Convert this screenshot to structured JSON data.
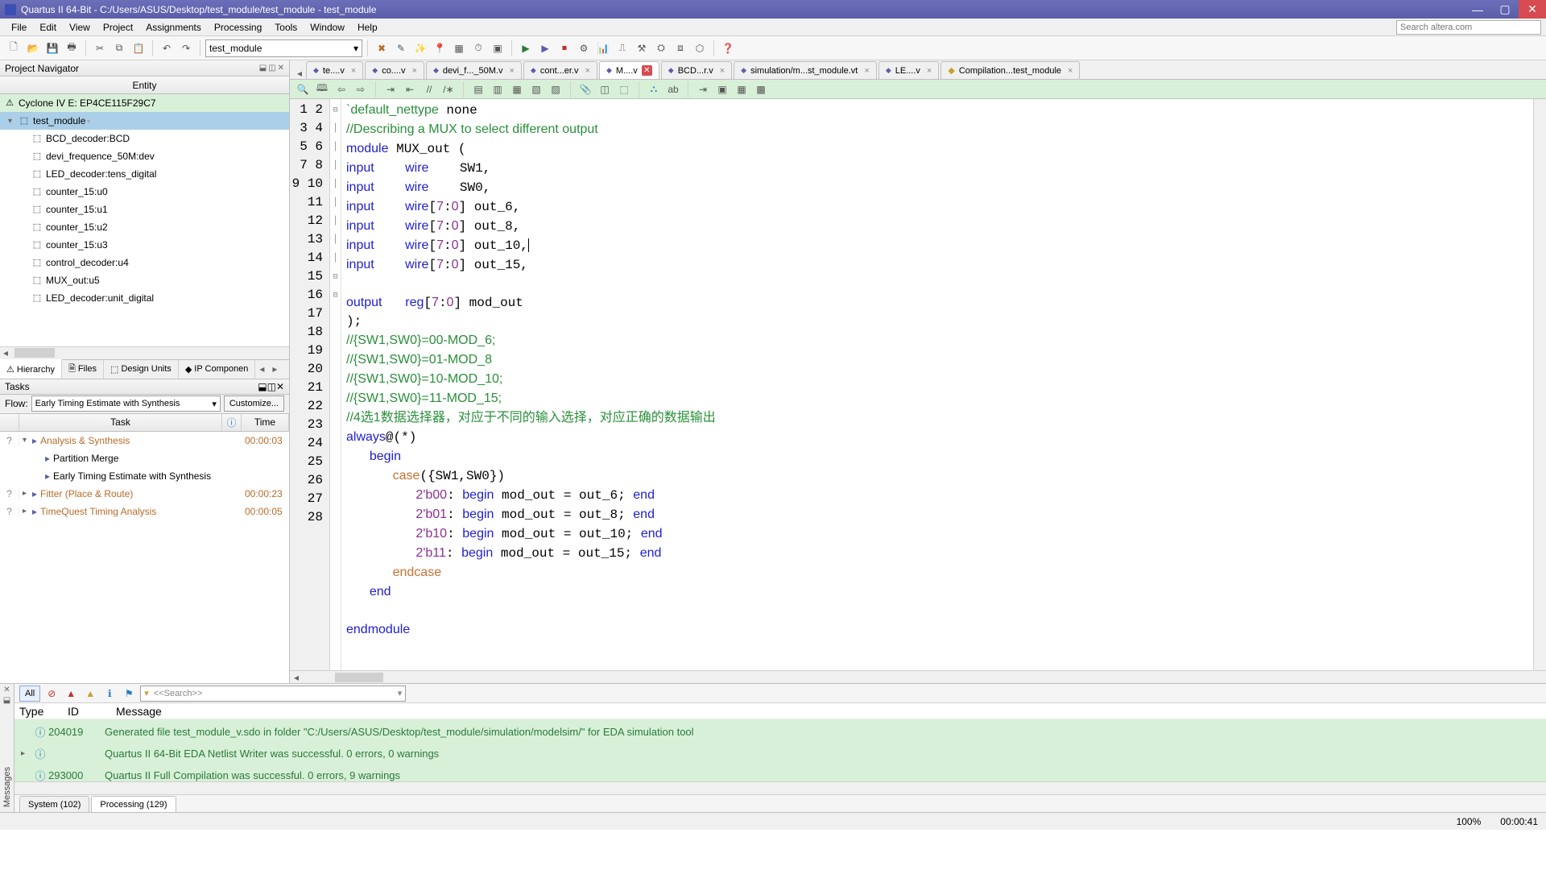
{
  "title": "Quartus II 64-Bit - C:/Users/ASUS/Desktop/test_module/test_module - test_module",
  "menus": [
    "File",
    "Edit",
    "View",
    "Project",
    "Assignments",
    "Processing",
    "Tools",
    "Window",
    "Help"
  ],
  "search_placeholder": "Search altera.com",
  "project_select": "test_module",
  "left": {
    "nav_title": "Project Navigator",
    "entity_header": "Entity",
    "device": "Cyclone IV E: EP4CE115F29C7",
    "top": "test_module",
    "instances": [
      "BCD_decoder:BCD",
      "devi_frequence_50M:dev",
      "LED_decoder:tens_digital",
      "counter_15:u0",
      "counter_15:u1",
      "counter_15:u2",
      "counter_15:u3",
      "control_decoder:u4",
      "MUX_out:u5",
      "LED_decoder:unit_digital"
    ],
    "tabs": [
      "Hierarchy",
      "Files",
      "Design Units",
      "IP Componen"
    ],
    "tasks_title": "Tasks",
    "flow_label": "Flow:",
    "flow_value": "Early Timing Estimate with Synthesis",
    "customize": "Customize...",
    "task_cols": [
      "Task",
      "Time"
    ],
    "status_icon": "ⓘ",
    "tasks": [
      {
        "name": "Analysis & Synthesis",
        "time": "00:00:03",
        "orange": true,
        "q": true,
        "exp": "▾",
        "arrow": true
      },
      {
        "name": "Partition Merge",
        "time": "",
        "orange": false,
        "q": false,
        "exp": "",
        "arrow": true,
        "indent": 16
      },
      {
        "name": "Early Timing Estimate with Synthesis",
        "time": "",
        "orange": false,
        "q": false,
        "exp": "",
        "arrow": true,
        "indent": 16
      },
      {
        "name": "Fitter (Place & Route)",
        "time": "00:00:23",
        "orange": true,
        "q": true,
        "exp": "▸",
        "arrow": true
      },
      {
        "name": "TimeQuest Timing Analysis",
        "time": "00:00:05",
        "orange": true,
        "q": true,
        "exp": "▸",
        "arrow": true
      }
    ]
  },
  "tabs": [
    {
      "label": "te....v"
    },
    {
      "label": "co....v"
    },
    {
      "label": "devi_f..._50M.v"
    },
    {
      "label": "cont...er.v"
    },
    {
      "label": "M....v",
      "active": true,
      "closeRed": true
    },
    {
      "label": "BCD...r.v"
    },
    {
      "label": "simulation/m...st_module.vt"
    },
    {
      "label": "LE....v"
    },
    {
      "label": "Compilation...test_module",
      "report": true
    }
  ],
  "code_lines": 28,
  "msgs": {
    "all": "All",
    "head_type": "Type",
    "head_id": "ID",
    "head_msg": "Message",
    "rows": [
      {
        "id": "204019",
        "text": "Generated file test_module_v.sdo in folder \"C:/Users/ASUS/Desktop/test_module/simulation/modelsim/\" for EDA simulation tool"
      },
      {
        "id": "",
        "text": "Quartus II 64-Bit EDA Netlist Writer was successful. 0 errors, 0 warnings",
        "exp": true
      },
      {
        "id": "293000",
        "text": "Quartus II Full Compilation was successful. 0 errors, 9 warnings"
      }
    ],
    "tabs": [
      "System (102)",
      "Processing (129)"
    ],
    "search": "<<Search>>"
  },
  "status": {
    "zoom": "100%",
    "time": "00:00:41"
  }
}
